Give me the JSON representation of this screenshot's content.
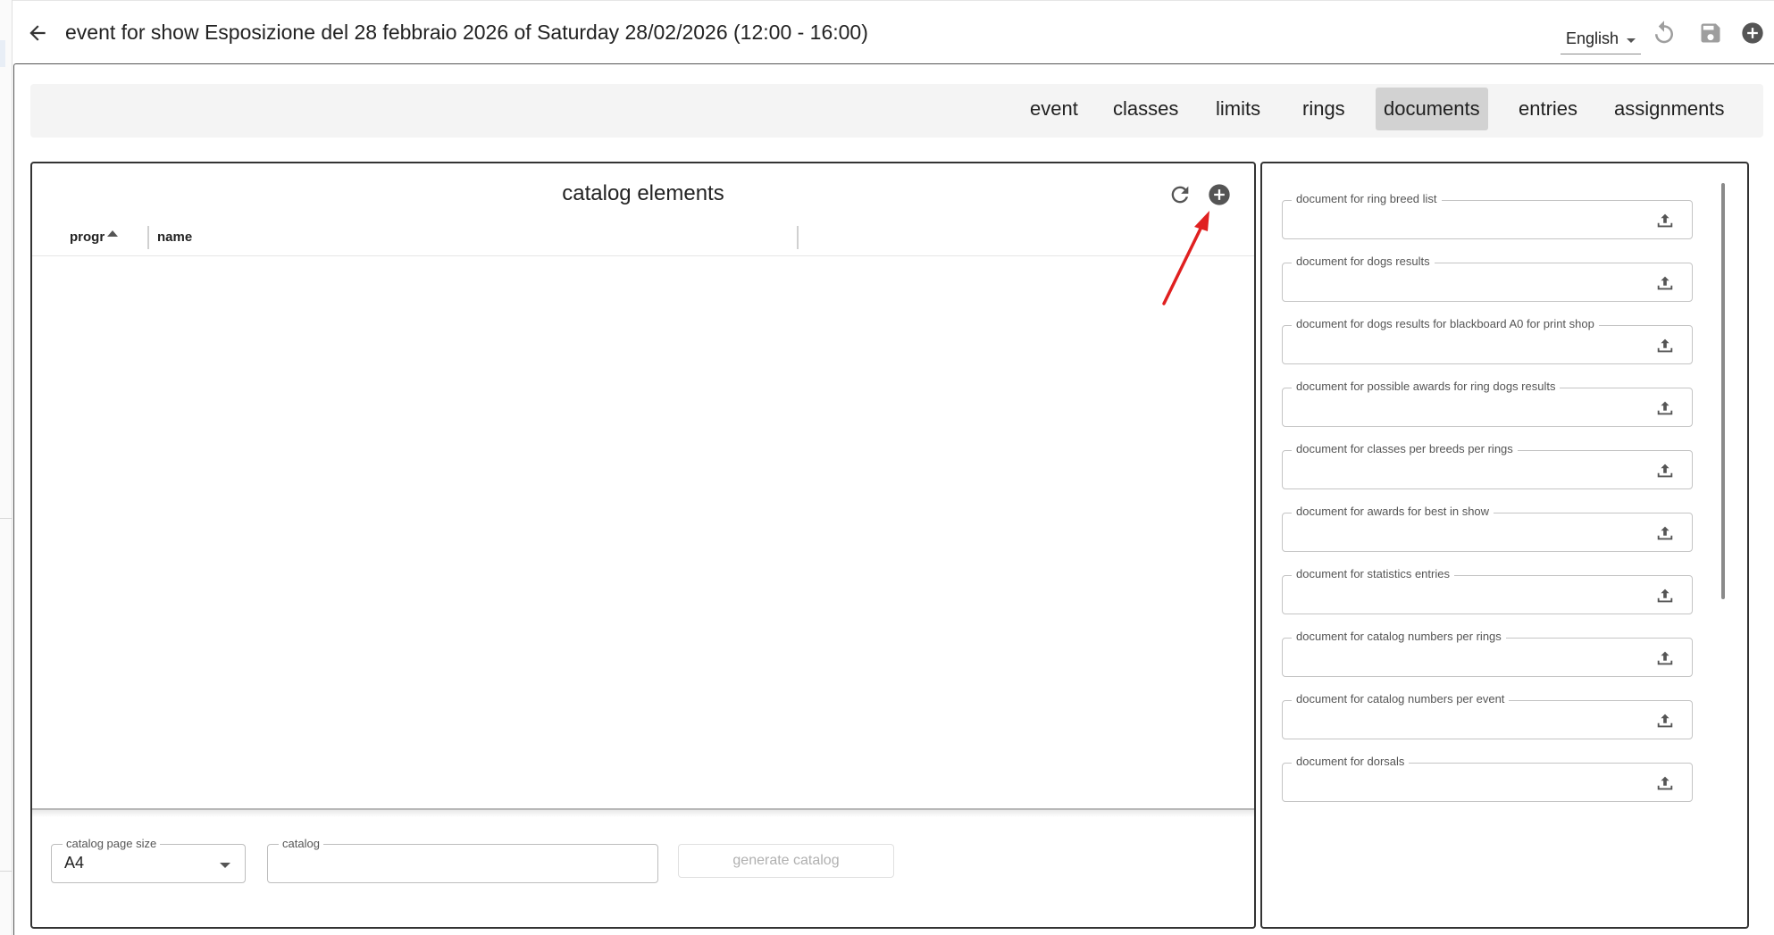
{
  "header": {
    "title": "event for show Esposizione del 28 febbraio 2026 of Saturday 28/02/2026 (12:00 - 16:00)",
    "language": "English",
    "icons": [
      "back-arrow-icon",
      "undo-icon",
      "save-icon",
      "add-circle-icon"
    ]
  },
  "tabs": [
    {
      "label": "event"
    },
    {
      "label": "classes"
    },
    {
      "label": "limits"
    },
    {
      "label": "rings"
    },
    {
      "label": "documents",
      "active": true
    },
    {
      "label": "entries"
    },
    {
      "label": "assignments"
    }
  ],
  "catalog": {
    "title": "catalog elements",
    "columns": [
      "progr",
      "name"
    ],
    "sort": "ascending",
    "rows": [],
    "page_size_label": "catalog page size",
    "page_size_value": "A4",
    "catalog_label": "catalog",
    "catalog_value": "",
    "generate_label": "generate catalog"
  },
  "documents": {
    "fields": [
      {
        "label": "document for ring breed list"
      },
      {
        "label": "document for dogs results"
      },
      {
        "label": "document for dogs results for blackboard A0 for print shop"
      },
      {
        "label": "document for possible awards for ring dogs results"
      },
      {
        "label": "document for classes per breeds per rings"
      },
      {
        "label": "document for awards for best in show"
      },
      {
        "label": "document for statistics entries"
      },
      {
        "label": "document for catalog numbers per rings"
      },
      {
        "label": "document for catalog numbers per event"
      },
      {
        "label": "document for dorsals"
      }
    ]
  },
  "colors": {
    "active_tab_bg": "#d2d2d2",
    "tabbar_bg": "#f4f4f4",
    "annotation_arrow": "#e02020",
    "icon_gray": "#555555",
    "disabled_icon": "#9e9e9e"
  }
}
